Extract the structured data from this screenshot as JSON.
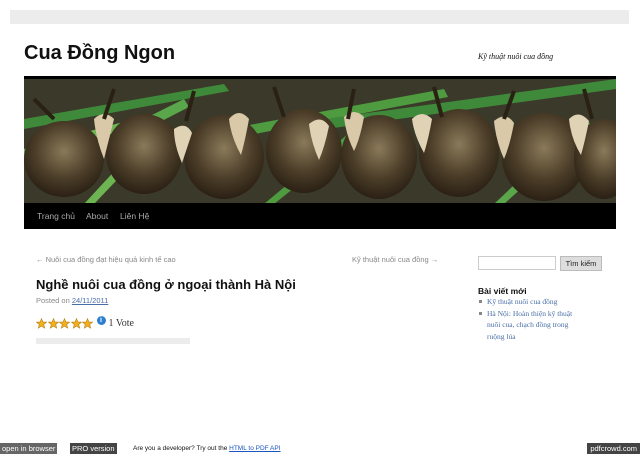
{
  "site": {
    "title": "Cua Đồng Ngon",
    "description": "Kỹ thuật nuôi cua đồng"
  },
  "nav": {
    "items": [
      {
        "label": "Trang chủ"
      },
      {
        "label": "About"
      },
      {
        "label": "Liên Hệ"
      }
    ]
  },
  "post_nav": {
    "previous": "← Nuôi cua đồng đạt hiệu quả kinh tế cao",
    "next": "Kỹ thuật nuôi cua đồng →"
  },
  "post": {
    "title": "Nghề nuôi cua đồng ở ngoại thành Hà Nội",
    "posted_on_label": "Posted on",
    "date": "24/11/2011",
    "rating_stars": 5,
    "rating_max": 5,
    "votes_text": "1 Vote"
  },
  "sidebar": {
    "search_button": "Tìm kiếm",
    "recent_title": "Bài viết mới",
    "recent_posts": [
      "Kỹ thuật nuôi cua đồng",
      "Hà Nội: Hoàn thiện kỹ thuật",
      "nuôi cua, chạch đồng trong",
      "ruộng lúa"
    ]
  },
  "footer": {
    "open_browser": "open in browser",
    "pro_version": "PRO version",
    "dev_text": "Are you a developer? Try out the",
    "dev_link": "HTML to PDF API",
    "brand": "pdfcrowd.com"
  },
  "colors": {
    "nav_background": "#000000",
    "link": "#4a6ea7",
    "star": "#f2b01e"
  }
}
